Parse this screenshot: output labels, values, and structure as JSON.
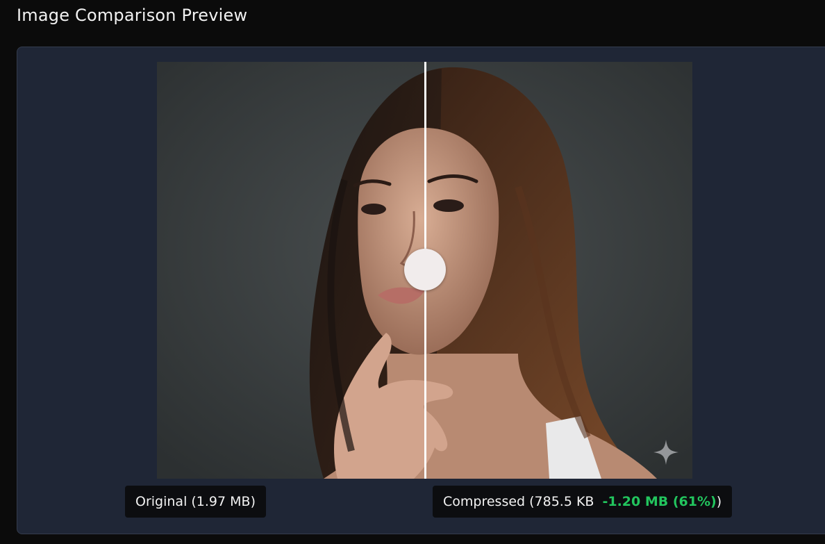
{
  "page": {
    "title": "Image Comparison Preview"
  },
  "comparison": {
    "original_label": "Original (1.97 MB)",
    "compressed_label_prefix": "Compressed (785.5 KB",
    "savings_text": "-1.20 MB (61%)",
    "compressed_label_suffix": ")",
    "slider_position_percent": 50,
    "savings_color": "#22c55e"
  },
  "icons": {
    "watermark": "sparkle-icon"
  }
}
